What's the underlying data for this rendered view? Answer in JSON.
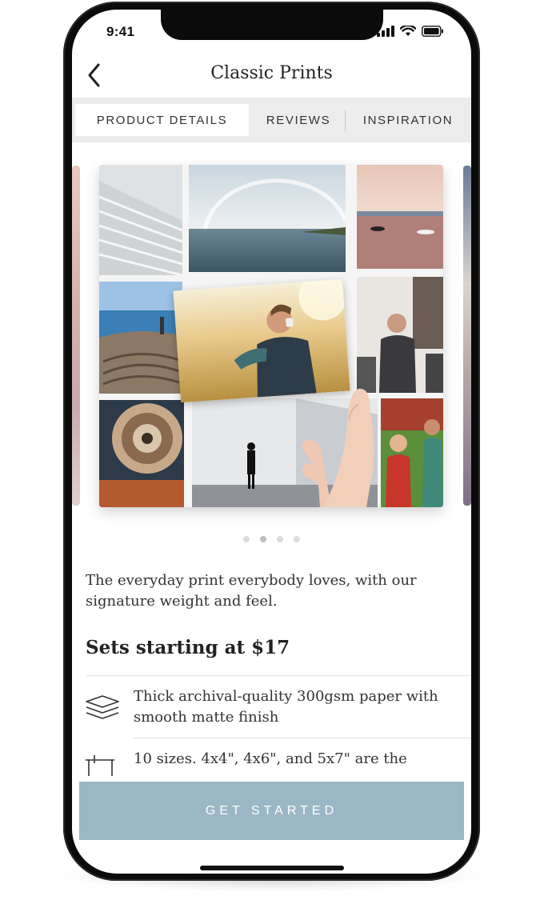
{
  "status_bar": {
    "time": "9:41"
  },
  "header": {
    "title": "Classic Prints"
  },
  "tabs": [
    {
      "label": "PRODUCT DETAILS",
      "active": true
    },
    {
      "label": "REVIEWS",
      "active": false
    },
    {
      "label": "INSPIRATION",
      "active": false
    }
  ],
  "carousel": {
    "page_count": 4,
    "active_index": 1
  },
  "product": {
    "description": "The everyday print everybody loves, with our signature weight and feel.",
    "price_heading": "Sets starting at $17",
    "features": [
      {
        "icon": "layers-icon",
        "text": "Thick archival-quality 300gsm paper with smooth matte finish"
      },
      {
        "icon": "ruler-icon",
        "text": "10 sizes. 4x4\", 4x6\", and 5x7\" are the"
      }
    ]
  },
  "cta": {
    "label": "GET STARTED"
  },
  "colors": {
    "accent": "#9bb7c6",
    "tab_bar": "#ededed",
    "text": "#333333"
  }
}
